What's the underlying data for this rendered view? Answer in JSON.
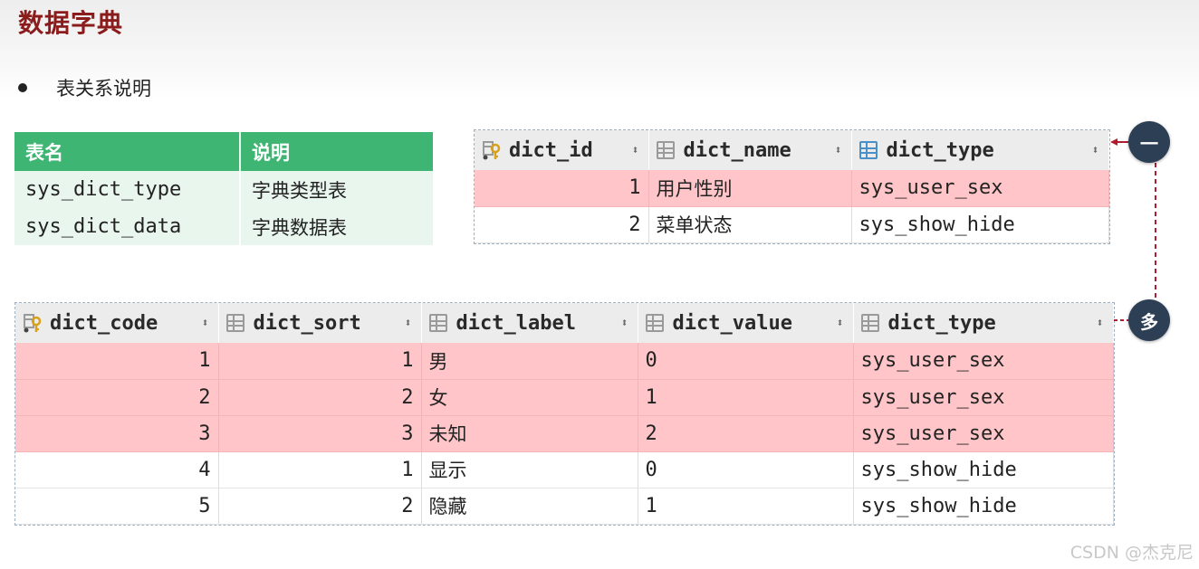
{
  "page": {
    "title": "数据字典",
    "bullet": "表关系说明",
    "watermark": "CSDN @杰克尼"
  },
  "summary_table": {
    "headers": [
      "表名",
      "说明"
    ],
    "rows": [
      [
        "sys_dict_type",
        "字典类型表"
      ],
      [
        "sys_dict_data",
        "字典数据表"
      ]
    ]
  },
  "dict_type_table": {
    "headers": [
      "dict_id",
      "dict_name",
      "dict_type"
    ],
    "rows": [
      {
        "dict_id": "1",
        "dict_name": "用户性别",
        "dict_type": "sys_user_sex",
        "highlight": true
      },
      {
        "dict_id": "2",
        "dict_name": "菜单状态",
        "dict_type": "sys_show_hide",
        "highlight": false
      }
    ]
  },
  "dict_data_table": {
    "headers": [
      "dict_code",
      "dict_sort",
      "dict_label",
      "dict_value",
      "dict_type"
    ],
    "rows": [
      {
        "dict_code": "1",
        "dict_sort": "1",
        "dict_label": "男",
        "dict_value": "0",
        "dict_type": "sys_user_sex",
        "highlight": true
      },
      {
        "dict_code": "2",
        "dict_sort": "2",
        "dict_label": "女",
        "dict_value": "1",
        "dict_type": "sys_user_sex",
        "highlight": true
      },
      {
        "dict_code": "3",
        "dict_sort": "3",
        "dict_label": "未知",
        "dict_value": "2",
        "dict_type": "sys_user_sex",
        "highlight": true
      },
      {
        "dict_code": "4",
        "dict_sort": "1",
        "dict_label": "显示",
        "dict_value": "0",
        "dict_type": "sys_show_hide",
        "highlight": false
      },
      {
        "dict_code": "5",
        "dict_sort": "2",
        "dict_label": "隐藏",
        "dict_value": "1",
        "dict_type": "sys_show_hide",
        "highlight": false
      }
    ]
  },
  "relation": {
    "one_label": "一",
    "many_label": "多",
    "line_color": "#b01c2e"
  },
  "icons": {
    "primary_key": "key-column-icon",
    "column": "column-icon",
    "sort": "sort-arrows-icon"
  },
  "colors": {
    "title": "#8b1c1c",
    "summary_header": "#3fb574",
    "summary_body": "#e9f6ee",
    "row_highlight": "#ffc5c8",
    "marker": "#2d3f55"
  }
}
